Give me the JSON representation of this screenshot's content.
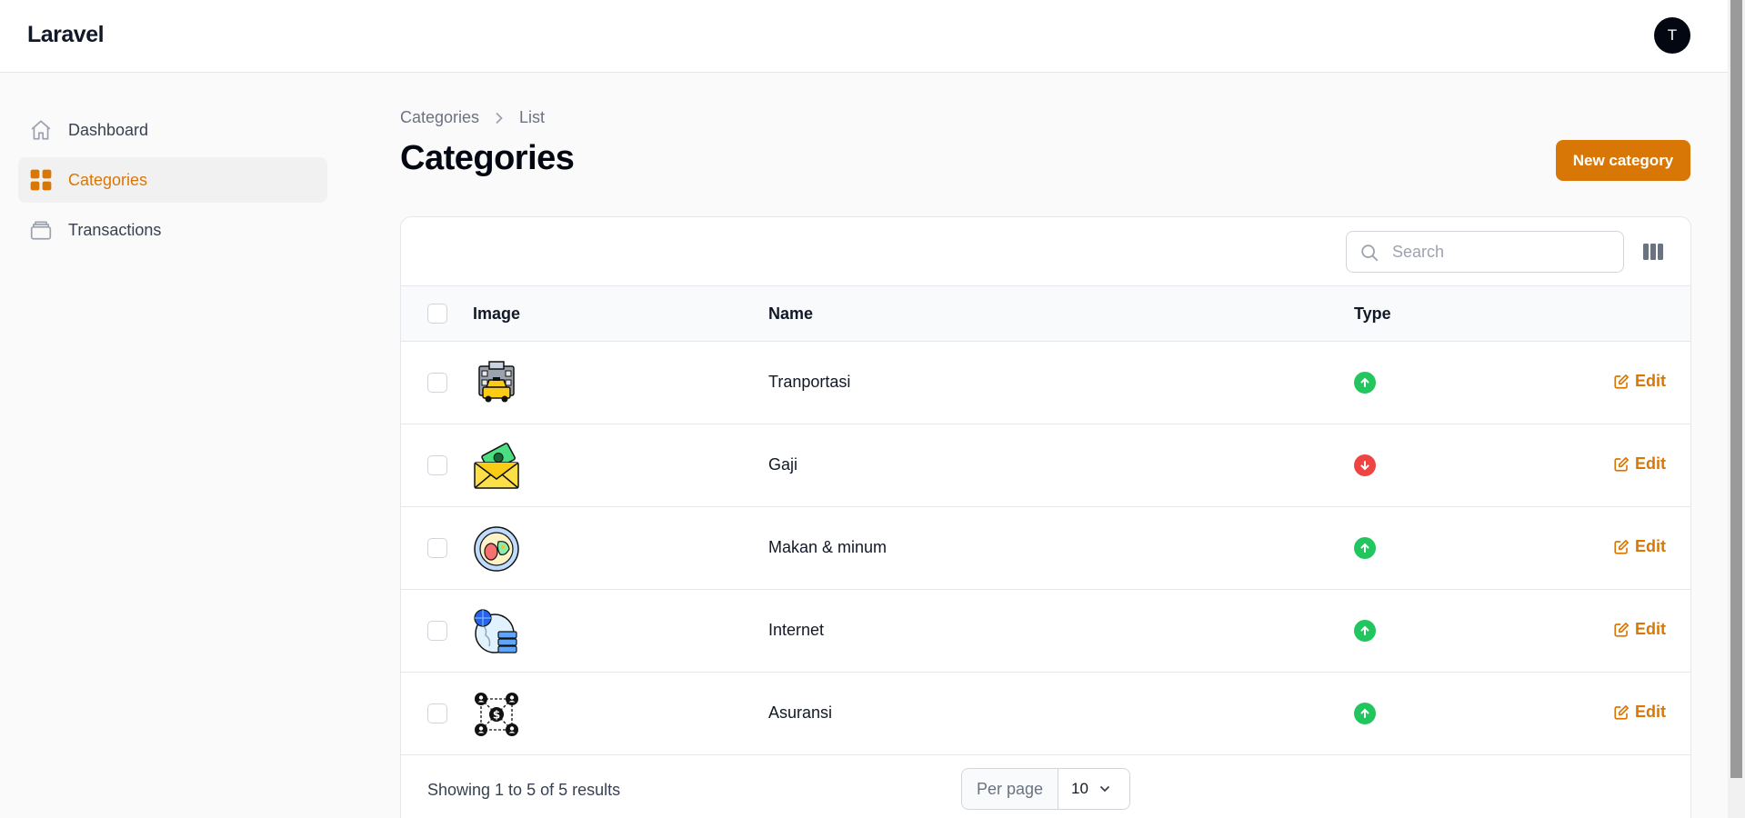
{
  "app": {
    "brand": "Laravel",
    "user_initial": "T"
  },
  "sidebar": {
    "items": [
      {
        "label": "Dashboard",
        "icon": "home-icon",
        "active": false
      },
      {
        "label": "Categories",
        "icon": "grid-icon",
        "active": true
      },
      {
        "label": "Transactions",
        "icon": "stack-icon",
        "active": false
      }
    ]
  },
  "breadcrumb": {
    "parent": "Categories",
    "current": "List"
  },
  "page": {
    "title": "Categories",
    "new_button": "New category"
  },
  "table": {
    "search_placeholder": "Search",
    "columns": {
      "image": "Image",
      "name": "Name",
      "type": "Type"
    },
    "edit_label": "Edit",
    "rows": [
      {
        "name": "Tranportasi",
        "image": "taxi-icon",
        "type": "up"
      },
      {
        "name": "Gaji",
        "image": "money-envelope-icon",
        "type": "down"
      },
      {
        "name": "Makan & minum",
        "image": "food-plate-icon",
        "type": "up"
      },
      {
        "name": "Internet",
        "image": "globe-server-icon",
        "type": "up"
      },
      {
        "name": "Asuransi",
        "image": "insurance-network-icon",
        "type": "up"
      }
    ],
    "footer": {
      "summary": "Showing 1 to 5 of 5 results",
      "per_page_label": "Per page",
      "per_page_value": "10"
    }
  },
  "colors": {
    "accent": "#d97706",
    "income": "#22c55e",
    "expense": "#ef4444"
  }
}
